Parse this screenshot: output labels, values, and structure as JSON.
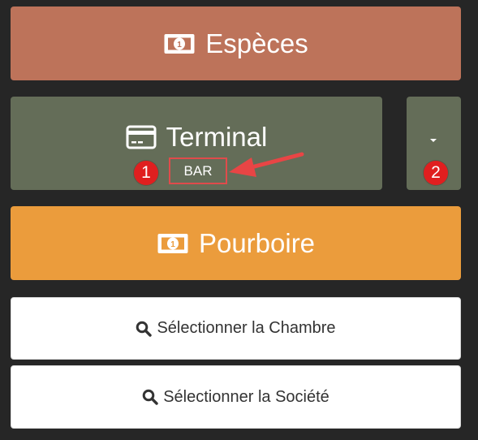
{
  "buttons": {
    "especes": {
      "label": "Espèces",
      "icon": "money-bill-icon",
      "color": "#bd735a"
    },
    "terminal": {
      "label": "Terminal",
      "sublabel": "BAR",
      "icon": "credit-card-icon",
      "color": "#646d58"
    },
    "terminal_dropdown": {
      "icon": "caret-down-icon"
    },
    "pourboire": {
      "label": "Pourboire",
      "icon": "money-bill-icon",
      "color": "#eb9c3c"
    },
    "select_chambre": {
      "label": "Sélectionner la Chambre",
      "icon": "search-icon"
    },
    "select_societe": {
      "label": "Sélectionner la Société",
      "icon": "search-icon"
    }
  },
  "annotations": {
    "badge_1": "1",
    "badge_2": "2",
    "highlight_color": "#e04b4b",
    "badge_color": "#e01f1f"
  }
}
